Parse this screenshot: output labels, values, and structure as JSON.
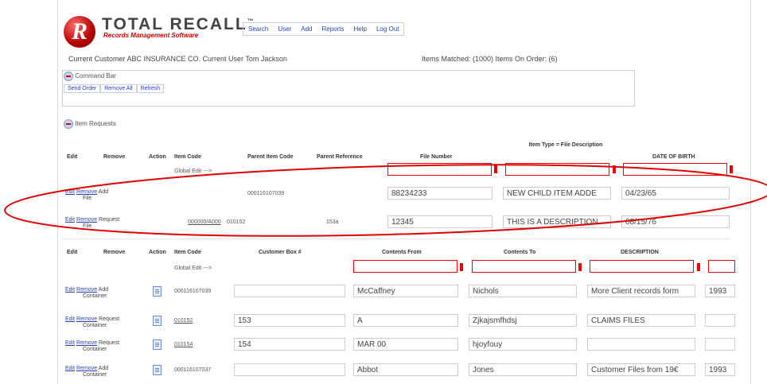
{
  "brand": {
    "name": "TOTAL RECALL",
    "tm": "™",
    "tagline": "Records Management Software"
  },
  "nav": [
    "Search",
    "User",
    "Add",
    "Reports",
    "Help",
    "Log Out"
  ],
  "status": {
    "customer": "Current Customer ABC INSURANCE CO.  Current User Tom Jackson",
    "matched": "Items Matched: (1000) Items On Order: (6)"
  },
  "command_bar": {
    "title": "Command Bar",
    "buttons": [
      "Send Order",
      "Remove All",
      "Refresh"
    ]
  },
  "item_requests": {
    "title": "Item Requests"
  },
  "file_table": {
    "headers": [
      "Edit",
      "Remove",
      "Action",
      "Item Code",
      "Parent Item Code",
      "Parent Reference",
      "File Number",
      "Item Type = File Description",
      "DATE OF BIRTH"
    ],
    "global_edit": "Global Edit --->",
    "rows": [
      {
        "edit": "Edit",
        "remove": "Remove",
        "action": "Add",
        "type": "File",
        "item_code": "",
        "parent_code": "000116107039",
        "parent_ref": "",
        "file_number": "88234233",
        "description": "NEW CHILD ITEM ADDE",
        "dob": "04/23/65"
      },
      {
        "edit": "Edit",
        "remove": "Remove",
        "action": "Request",
        "type": "File",
        "item_code": "000000/A000",
        "parent_code": "010152",
        "parent_ref": "153a",
        "file_number": "12345",
        "description": "THIS IS A DESCRIPTION",
        "dob": "08/15/76"
      }
    ]
  },
  "box_table": {
    "headers": [
      "Edit",
      "Remove",
      "Action",
      "Item Code",
      "Customer Box #",
      "Contents From",
      "Contents To",
      "DESCRIPTION"
    ],
    "global_edit": "Global Edit --->",
    "rows": [
      {
        "edit": "Edit",
        "remove": "Remove",
        "action": "Add",
        "type": "Container",
        "item_code": "000116107039",
        "box": "",
        "from": "McCaffney",
        "to": "Nichols",
        "desc": "More Client records form",
        "extra": "1993"
      },
      {
        "edit": "Edit",
        "remove": "Remove",
        "action": "Request",
        "type": "Container",
        "item_code": "010152",
        "box": "153",
        "from": "A",
        "to": "Zjkajsmfhdsj",
        "desc": "CLAIMS FILES",
        "extra": ""
      },
      {
        "edit": "Edit",
        "remove": "Remove",
        "action": "Request",
        "type": "Container",
        "item_code": "010154",
        "box": "154",
        "from": "MAR 00",
        "to": "hjoyfouy",
        "desc": "",
        "extra": ""
      },
      {
        "edit": "Edit",
        "remove": "Remove",
        "action": "Add",
        "type": "Container",
        "item_code": "000116107037",
        "box": "",
        "from": "Abbot",
        "to": "Jones",
        "desc": "Customer Files from 19€",
        "extra": "1993"
      }
    ]
  },
  "colors": {
    "accent": "#2a3fbf",
    "highlight": "#e00000",
    "brand_red": "#c00000"
  }
}
